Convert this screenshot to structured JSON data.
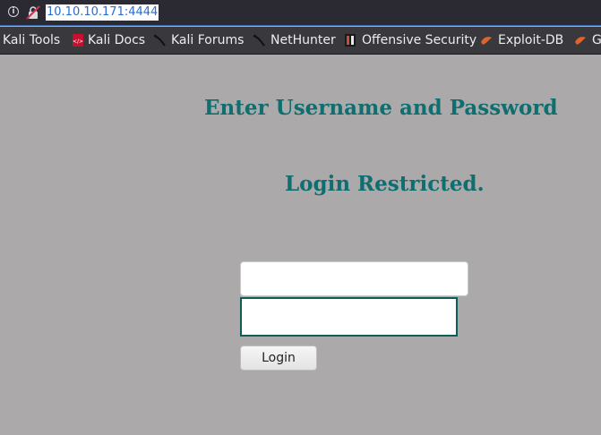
{
  "browser": {
    "url": "10.10.10.171:4444",
    "url_icons": [
      "info-icon",
      "insecure-lock-icon"
    ]
  },
  "bookmarks": [
    {
      "label": "Kali Tools",
      "icon": null
    },
    {
      "label": "Kali Docs",
      "icon": "kali-docs-icon"
    },
    {
      "label": "Kali Forums",
      "icon": "kali-dragon-icon"
    },
    {
      "label": "NetHunter",
      "icon": "kali-dragon-icon"
    },
    {
      "label": "Offensive Security",
      "icon": "offsec-icon"
    },
    {
      "label": "Exploit-DB",
      "icon": "exploit-db-icon"
    },
    {
      "label": "G",
      "icon": "exploit-db-icon"
    }
  ],
  "page": {
    "heading": "Enter Username and Password",
    "subheading": "Login Restricted.",
    "username_value": "",
    "password_value": "",
    "login_label": "Login"
  },
  "colors": {
    "page_background": "#ABA9A9",
    "heading_color": "#0E6E70",
    "toolbar": "#38383D"
  }
}
